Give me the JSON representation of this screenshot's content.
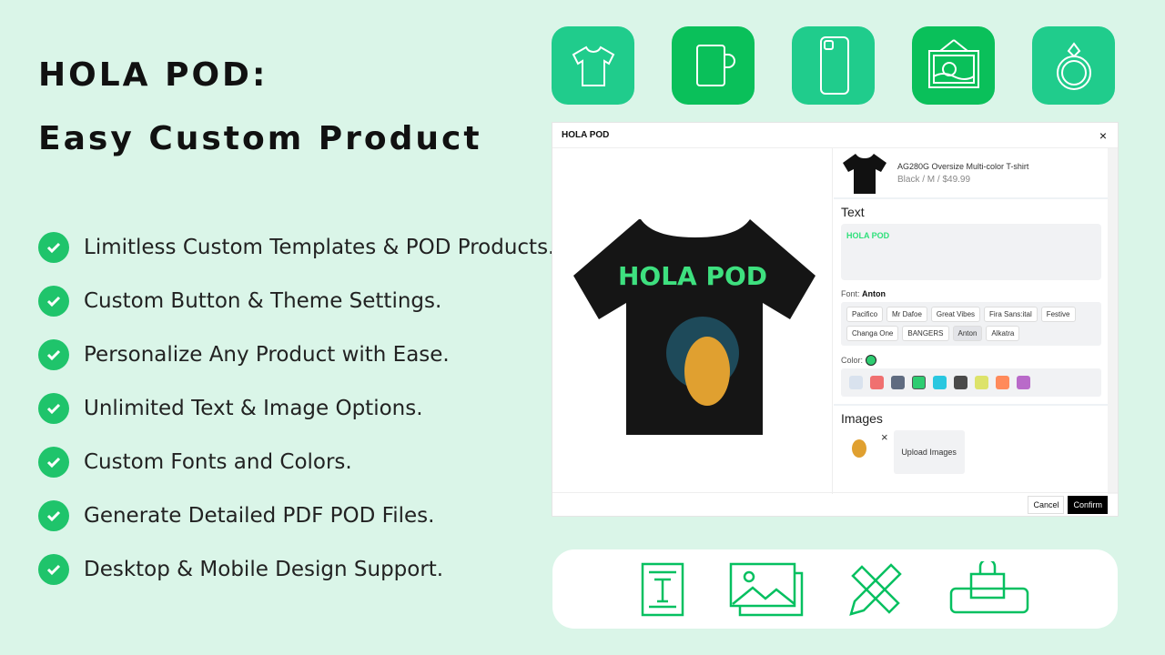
{
  "headline": {
    "line1": "HOLA POD:",
    "line2": "Easy Custom Product"
  },
  "features": [
    "Limitless Custom Templates & POD Products.",
    "Custom Button & Theme Settings.",
    "Personalize Any Product with Ease.",
    "Unlimited Text & Image Options.",
    "Custom Fonts and Colors.",
    "Generate Detailed PDF POD Files.",
    "Desktop & Mobile Design Support."
  ],
  "top_icons": [
    "tshirt-icon",
    "mug-icon",
    "phone-case-icon",
    "wall-art-icon",
    "ring-icon"
  ],
  "dialog": {
    "title": "HOLA POD",
    "close": "×",
    "product": {
      "name": "AG280G Oversize Multi-color T-shirt",
      "variant": "Black / M / $49.99"
    },
    "preview_text": "HOLA POD",
    "text_heading": "Text",
    "text_value": "HOLA POD",
    "font_label": "Font:",
    "font_value": "Anton",
    "fonts": [
      "Pacifico",
      "Mr Dafoe",
      "Great Vibes",
      "Fira Sans:ital",
      "Festive",
      "Changa One",
      "BANGERS",
      "Anton",
      "Alkatra"
    ],
    "color_label": "Color:",
    "selected_color": "#2ecc71",
    "colors": [
      "#d9e2ee",
      "#f07070",
      "#5f6b80",
      "#2ecc71",
      "#29c7e0",
      "#4a4a4a",
      "#dde36a",
      "#ff8a5b",
      "#b96ac9"
    ],
    "images_heading": "Images",
    "remove": "×",
    "upload": "Upload Images",
    "cancel": "Cancel",
    "confirm": "Confirm"
  },
  "bottom_icons": [
    "text-document-icon",
    "image-gallery-icon",
    "design-tools-icon",
    "mobile-shopping-icon"
  ],
  "colors": {
    "background": "#daf5e8",
    "accent": "#20cc8c",
    "accent_dark": "#0ac05a"
  }
}
